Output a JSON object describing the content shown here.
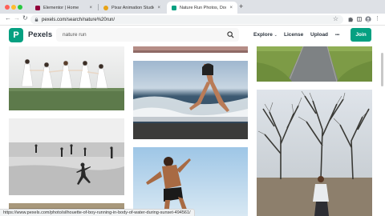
{
  "browser": {
    "tabs": [
      {
        "title": "Elementor | Home",
        "active": false,
        "favicon_color": "#92003b"
      },
      {
        "title": "Pixar Animation Studios",
        "active": false,
        "favicon_color": "#e8a317"
      },
      {
        "title": "Nature Run Photos, Download",
        "active": true,
        "favicon_color": "#05a081"
      }
    ],
    "new_tab_label": "+",
    "close_label": "×",
    "address": "pexels.com/search/nature%20run/",
    "status_url": "https://www.pexels.com/photo/silhouette-of-boy-running-in-body-of-water-during-sunset-494561/"
  },
  "site": {
    "logo_letter": "P",
    "logo_name": "Pexels",
    "search_value": "nature run",
    "nav": {
      "explore": "Explore",
      "license": "License",
      "upload": "Upload",
      "more": "•••"
    },
    "join_label": "Join",
    "accent": "#05a081"
  },
  "photos": [
    "women-running-in-field",
    "beach-runner-legs",
    "runner-on-beach-silhouette",
    "man-running-shirtless",
    "country-road",
    "woman-running-in-park",
    "top-banner-partial"
  ]
}
